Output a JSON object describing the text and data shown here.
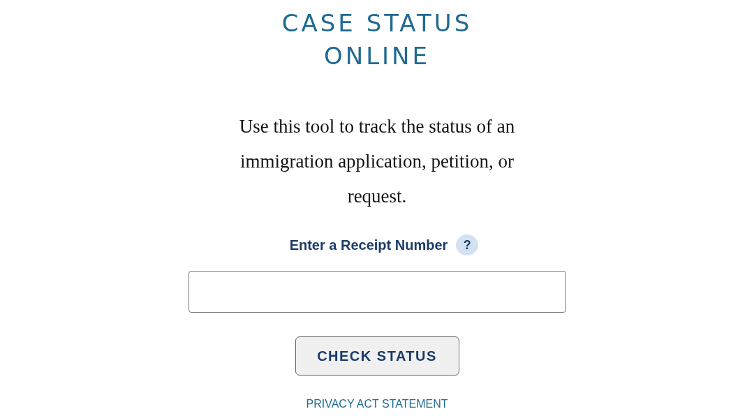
{
  "title_lines": [
    "CASE STATUS",
    "ONLINE"
  ],
  "intro": "Use this tool to track the status of an immigration application, petition, or request.",
  "receipt_field": {
    "label": "Enter a Receipt Number",
    "help_icon": "?"
  },
  "submit_button": "CHECK STATUS",
  "privacy_link": "PRIVACY ACT STATEMENT"
}
